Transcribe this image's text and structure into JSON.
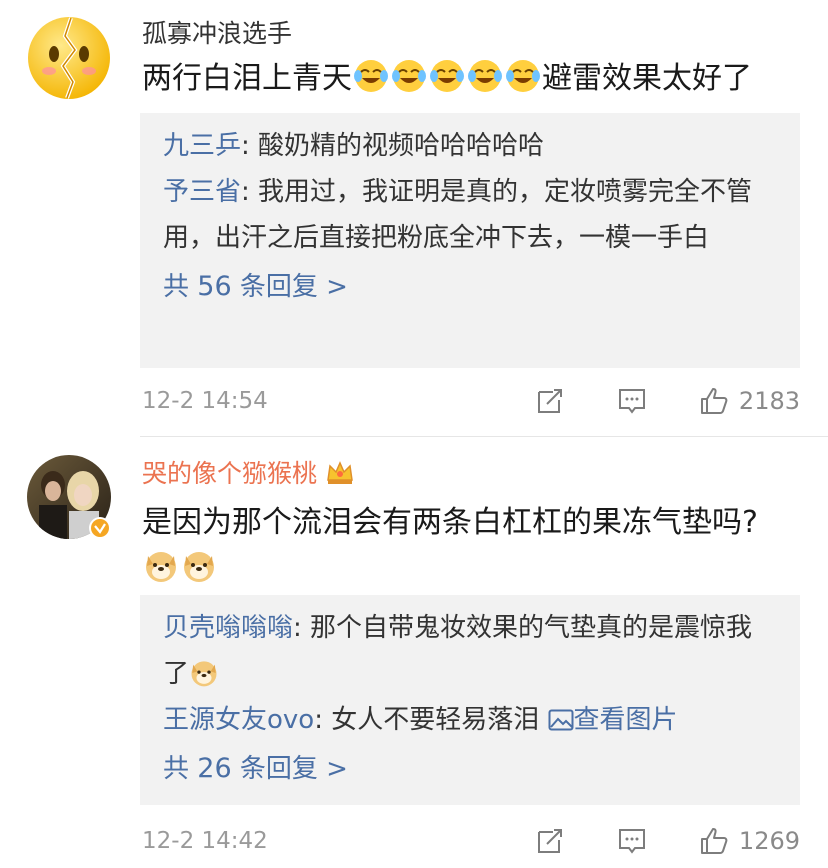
{
  "comments": [
    {
      "username": "孤寡冲浪选手",
      "text_before": "两行白泪上青天",
      "text_after": "避雷效果太好了",
      "emoji_icon": "laugh-cry-emoji",
      "replies": [
        {
          "name": "九三乒",
          "sep": ": ",
          "text": "酸奶精的视频哈哈哈哈哈"
        },
        {
          "name": "予三省",
          "sep": ": ",
          "text": "我用过，我证明是真的，定妆喷雾完全不管用，出汗之后直接把粉底全冲下去，一模一手白"
        }
      ],
      "more_prefix": "共",
      "more_count": "56",
      "more_suffix": "条回复 >",
      "time": "12-2 14:54",
      "likes": "2183"
    },
    {
      "username": "哭的像个猕猴桃",
      "text": "是因为那个流泪会有两条白杠杠的果冻气垫吗?",
      "emoji_icon": "doge-emoji",
      "badge_icon": "crown-badge-icon",
      "verified_icon": "verified-v-icon",
      "replies": [
        {
          "name": "贝壳嗡嗡嗡",
          "sep": ": ",
          "text": "那个自带鬼妆效果的气垫真的是震惊我了"
        },
        {
          "name": "王源女友ovo",
          "sep": ": ",
          "text": "女人不要轻易落泪 ",
          "link": "查看图片"
        }
      ],
      "more_prefix": "共",
      "more_count": "26",
      "more_suffix": "条回复 >",
      "time": "12-2 14:42",
      "likes": "1269"
    }
  ],
  "colors": {
    "username_vip": "#eb7350",
    "reply_name": "#4a6fa5",
    "reply_bg": "#f2f2f2",
    "meta_text": "#9a9a9a"
  }
}
